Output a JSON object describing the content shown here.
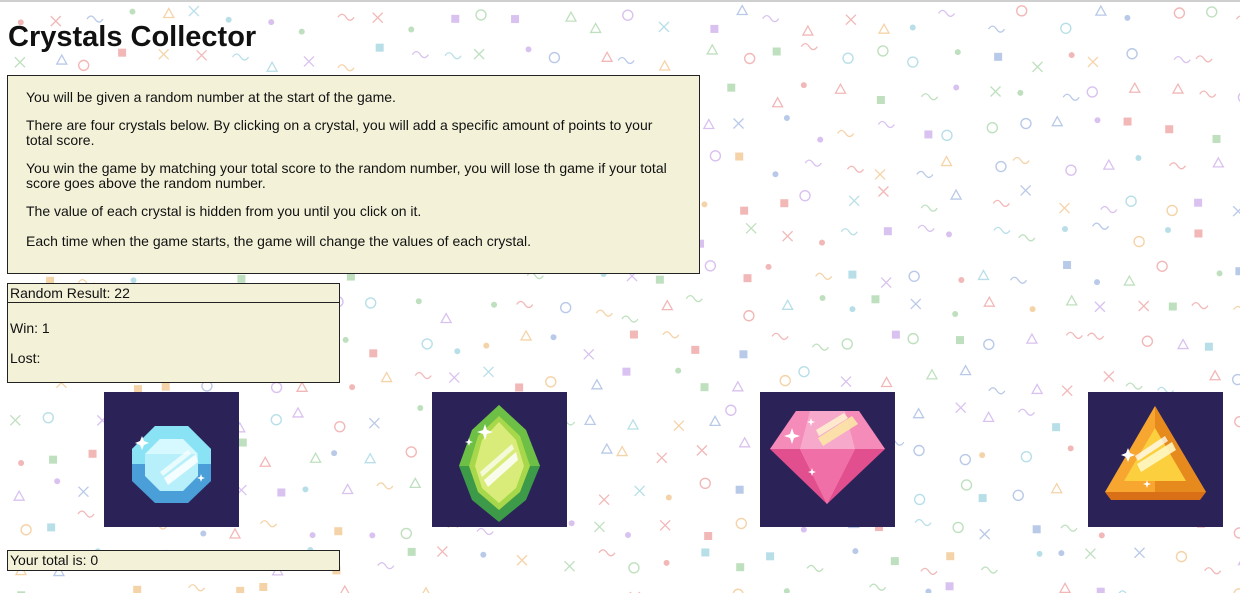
{
  "title": "Crystals Collector",
  "instructions": [
    "You will be given a random number at the start of the game.",
    "There are four crystals below. By clicking on a crystal, you will add a specific amount of points to your total score.",
    "You win the game by matching your total score to the random number, you will lose th game if your total score goes above the random number.",
    "The value of each crystal is hidden from you until you click on it.",
    "Each time when the game starts, the game will change the values of each crystal."
  ],
  "random_result": {
    "label": "Random Result: ",
    "value": "22"
  },
  "wins": {
    "label": "Win: ",
    "value": "1"
  },
  "losses": {
    "label": "Lost: ",
    "value": ""
  },
  "total": {
    "label": "Your total is: ",
    "value": "0"
  },
  "crystals": [
    {
      "name": "blue-crystal",
      "color": "#6fd9f0"
    },
    {
      "name": "green-crystal",
      "color": "#7ec84a"
    },
    {
      "name": "pink-crystal",
      "color": "#f06fa6"
    },
    {
      "name": "orange-crystal",
      "color": "#f5a32a"
    }
  ],
  "colors": {
    "panel": "#f3f2d9",
    "tile": "#2b2358",
    "border": "#222222"
  }
}
